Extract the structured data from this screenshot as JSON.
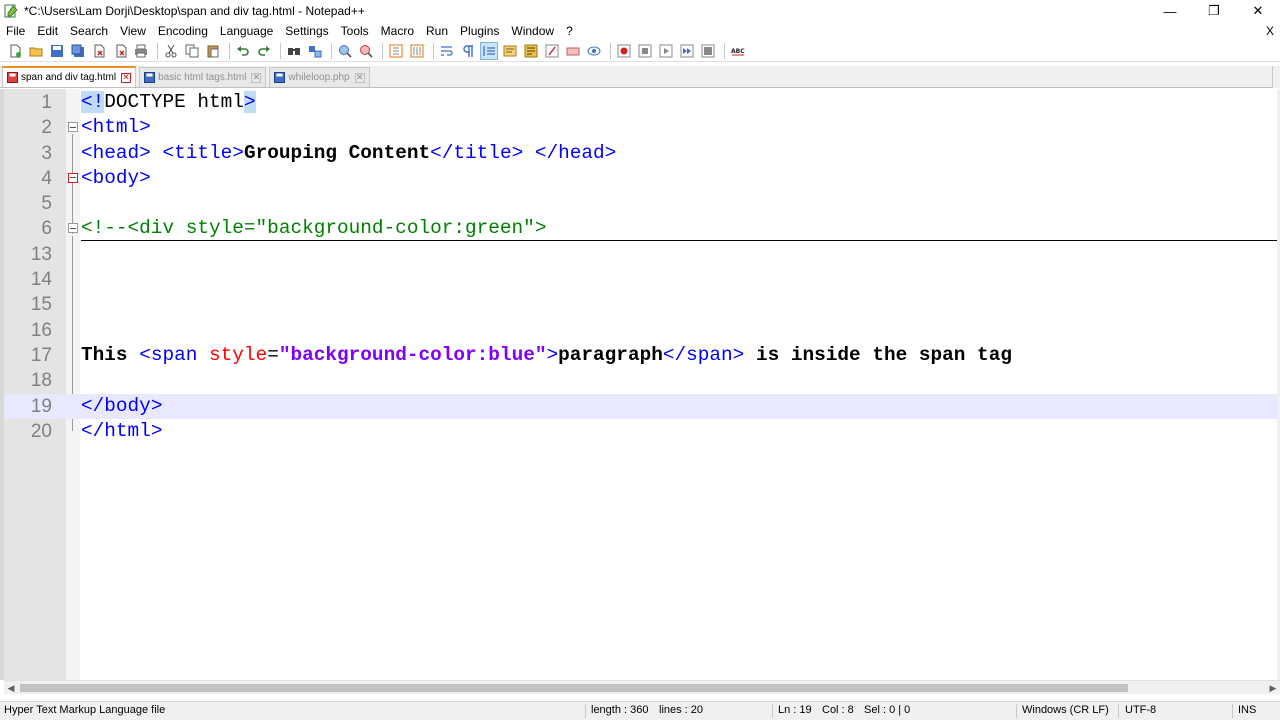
{
  "window": {
    "title": "*C:\\Users\\Lam Dorji\\Desktop\\span and div tag.html - Notepad++",
    "controls": {
      "minimize": "—",
      "restore": "❐",
      "close": "✕"
    }
  },
  "menu": {
    "items": [
      "File",
      "Edit",
      "Search",
      "View",
      "Encoding",
      "Language",
      "Settings",
      "Tools",
      "Macro",
      "Run",
      "Plugins",
      "Window",
      "?"
    ],
    "close_doc": "X"
  },
  "tabs": [
    {
      "label": "span and div tag.html",
      "active": true
    },
    {
      "label": "basic html tags.html",
      "active": false
    },
    {
      "label": "whileloop.php",
      "active": false
    }
  ],
  "editor": {
    "line_numbers": [
      "1",
      "2",
      "3",
      "4",
      "5",
      "6",
      "13",
      "14",
      "15",
      "16",
      "17",
      "18",
      "19",
      "20"
    ],
    "current_line": "19",
    "code": {
      "l1_a": "<!",
      "l1_b": "DOCTYPE html",
      "l1_c": ">",
      "l2": "<html>",
      "l3_open_head": "<head>",
      "l3_open_title": "<title>",
      "l3_text": "Grouping Content",
      "l3_close_title": "</title>",
      "l3_close_head": "</head>",
      "l4": "<body>",
      "l6": "<!--<div style=\"background-color:green\">",
      "l17_text1": "This ",
      "l17_span_open": "<span ",
      "l17_attr": "style",
      "l17_eq": "=",
      "l17_val": "\"background-color:blue\"",
      "l17_gt": ">",
      "l17_word": "paragraph",
      "l17_span_close": "</span>",
      "l17_text2": " is inside the span tag",
      "l19": "</body>",
      "l20": "</html>"
    }
  },
  "status": {
    "file_type": "Hyper Text Markup Language file",
    "length": "length : 360",
    "lines": "lines : 20",
    "ln": "Ln : 19",
    "col": "Col : 8",
    "sel": "Sel : 0 | 0",
    "eol": "Windows (CR LF)",
    "encoding": "UTF-8",
    "mode": "INS"
  }
}
